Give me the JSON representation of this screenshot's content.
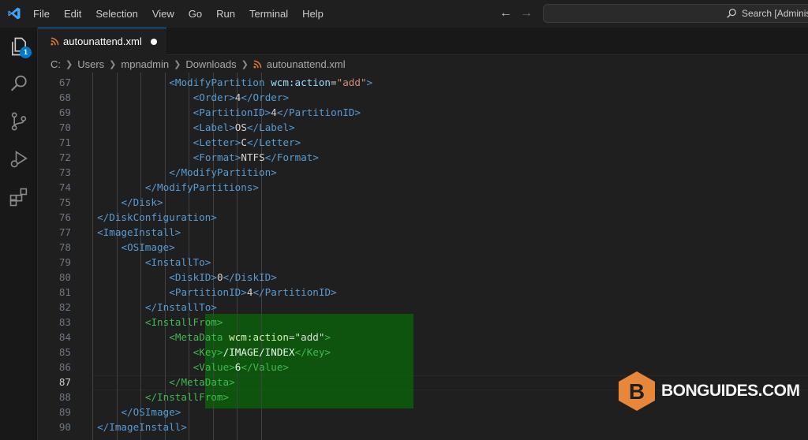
{
  "menu": [
    "File",
    "Edit",
    "Selection",
    "View",
    "Go",
    "Run",
    "Terminal",
    "Help"
  ],
  "search": {
    "text": "Search [Adminis"
  },
  "activity": {
    "explorer_badge": "1"
  },
  "tab": {
    "label": "autounattend.xml"
  },
  "breadcrumb": [
    "C:",
    "Users",
    "mpnadmin",
    "Downloads",
    "autounattend.xml"
  ],
  "editor": {
    "current_line": "87",
    "lines": [
      {
        "n": "67",
        "tokens": [
          [
            "t",
            "<"
          ],
          [
            "tn",
            "ModifyPartition"
          ],
          [
            "tx",
            " "
          ],
          [
            "an",
            "wcm:action"
          ],
          [
            "eq",
            "="
          ],
          [
            "av",
            "\"add\""
          ],
          [
            "t",
            ">"
          ]
        ]
      },
      {
        "n": "68",
        "tokens": [
          [
            "t",
            "<"
          ],
          [
            "tn",
            "Order"
          ],
          [
            "t",
            ">"
          ],
          [
            "tx",
            "4"
          ],
          [
            "t",
            "</"
          ],
          [
            "tn",
            "Order"
          ],
          [
            "t",
            ">"
          ]
        ]
      },
      {
        "n": "69",
        "tokens": [
          [
            "t",
            "<"
          ],
          [
            "tn",
            "PartitionID"
          ],
          [
            "t",
            ">"
          ],
          [
            "tx",
            "4"
          ],
          [
            "t",
            "</"
          ],
          [
            "tn",
            "PartitionID"
          ],
          [
            "t",
            ">"
          ]
        ]
      },
      {
        "n": "70",
        "tokens": [
          [
            "t",
            "<"
          ],
          [
            "tn",
            "Label"
          ],
          [
            "t",
            ">"
          ],
          [
            "tx",
            "OS"
          ],
          [
            "t",
            "</"
          ],
          [
            "tn",
            "Label"
          ],
          [
            "t",
            ">"
          ]
        ]
      },
      {
        "n": "71",
        "tokens": [
          [
            "t",
            "<"
          ],
          [
            "tn",
            "Letter"
          ],
          [
            "t",
            ">"
          ],
          [
            "tx",
            "C"
          ],
          [
            "t",
            "</"
          ],
          [
            "tn",
            "Letter"
          ],
          [
            "t",
            ">"
          ]
        ]
      },
      {
        "n": "72",
        "tokens": [
          [
            "t",
            "<"
          ],
          [
            "tn",
            "Format"
          ],
          [
            "t",
            ">"
          ],
          [
            "tx",
            "NTFS"
          ],
          [
            "t",
            "</"
          ],
          [
            "tn",
            "Format"
          ],
          [
            "t",
            ">"
          ]
        ]
      },
      {
        "n": "73",
        "tokens": [
          [
            "t",
            "</"
          ],
          [
            "tn",
            "ModifyPartition"
          ],
          [
            "t",
            ">"
          ]
        ]
      },
      {
        "n": "74",
        "tokens": [
          [
            "t",
            "</"
          ],
          [
            "tn",
            "ModifyPartitions"
          ],
          [
            "t",
            ">"
          ]
        ]
      },
      {
        "n": "75",
        "tokens": [
          [
            "t",
            "</"
          ],
          [
            "tn",
            "Disk"
          ],
          [
            "t",
            ">"
          ]
        ]
      },
      {
        "n": "76",
        "tokens": [
          [
            "t",
            "</"
          ],
          [
            "tn",
            "DiskConfiguration"
          ],
          [
            "t",
            ">"
          ]
        ]
      },
      {
        "n": "77",
        "tokens": [
          [
            "t",
            "<"
          ],
          [
            "tn",
            "ImageInstall"
          ],
          [
            "t",
            ">"
          ]
        ]
      },
      {
        "n": "78",
        "tokens": [
          [
            "t",
            "<"
          ],
          [
            "tn",
            "OSImage"
          ],
          [
            "t",
            ">"
          ]
        ]
      },
      {
        "n": "79",
        "tokens": [
          [
            "t",
            "<"
          ],
          [
            "tn",
            "InstallTo"
          ],
          [
            "t",
            ">"
          ]
        ]
      },
      {
        "n": "80",
        "tokens": [
          [
            "t",
            "<"
          ],
          [
            "tn",
            "DiskID"
          ],
          [
            "t",
            ">"
          ],
          [
            "tx",
            "0"
          ],
          [
            "t",
            "</"
          ],
          [
            "tn",
            "DiskID"
          ],
          [
            "t",
            ">"
          ]
        ]
      },
      {
        "n": "81",
        "tokens": [
          [
            "t",
            "<"
          ],
          [
            "tn",
            "PartitionID"
          ],
          [
            "t",
            ">"
          ],
          [
            "tx",
            "4"
          ],
          [
            "t",
            "</"
          ],
          [
            "tn",
            "PartitionID"
          ],
          [
            "t",
            ">"
          ]
        ]
      },
      {
        "n": "82",
        "tokens": [
          [
            "t",
            "</"
          ],
          [
            "tn",
            "InstallTo"
          ],
          [
            "t",
            ">"
          ]
        ]
      },
      {
        "n": "83",
        "tokens": [
          [
            "t",
            "<"
          ],
          [
            "tn",
            "InstallFrom"
          ],
          [
            "t",
            ">"
          ]
        ]
      },
      {
        "n": "84",
        "tokens": [
          [
            "t",
            "<"
          ],
          [
            "tn",
            "MetaData"
          ],
          [
            "tx",
            " "
          ],
          [
            "an",
            "wcm:action"
          ],
          [
            "eq",
            "="
          ],
          [
            "av",
            "\"add\""
          ],
          [
            "t",
            ">"
          ]
        ]
      },
      {
        "n": "85",
        "tokens": [
          [
            "t",
            "<"
          ],
          [
            "tn",
            "Key"
          ],
          [
            "t",
            ">"
          ],
          [
            "tx",
            "/IMAGE/INDEX"
          ],
          [
            "t",
            "</"
          ],
          [
            "tn",
            "Key"
          ],
          [
            "t",
            ">"
          ]
        ]
      },
      {
        "n": "86",
        "tokens": [
          [
            "t",
            "<"
          ],
          [
            "tn",
            "Value"
          ],
          [
            "t",
            ">"
          ],
          [
            "tx",
            "6"
          ],
          [
            "t",
            "</"
          ],
          [
            "tn",
            "Value"
          ],
          [
            "t",
            ">"
          ]
        ]
      },
      {
        "n": "87",
        "tokens": [
          [
            "t",
            "</"
          ],
          [
            "tn",
            "MetaData"
          ],
          [
            "t",
            ">"
          ]
        ]
      },
      {
        "n": "88",
        "tokens": [
          [
            "t",
            "</"
          ],
          [
            "tn",
            "InstallFrom"
          ],
          [
            "t",
            ">"
          ]
        ]
      },
      {
        "n": "89",
        "tokens": [
          [
            "t",
            "</"
          ],
          [
            "tn",
            "OSImage"
          ],
          [
            "t",
            ">"
          ]
        ]
      },
      {
        "n": "90",
        "tokens": [
          [
            "t",
            "</"
          ],
          [
            "tn",
            "ImageInstall"
          ],
          [
            "t",
            ">"
          ]
        ]
      }
    ]
  },
  "watermark": {
    "text": "BONGUIDES.COM",
    "logo_letter": "B"
  },
  "colors": {
    "accent": "#0078d4",
    "tag": "#569cd6",
    "attr": "#9cdcfe",
    "string": "#ce9178",
    "selection": "#008000",
    "watermark": "#e8873a"
  }
}
